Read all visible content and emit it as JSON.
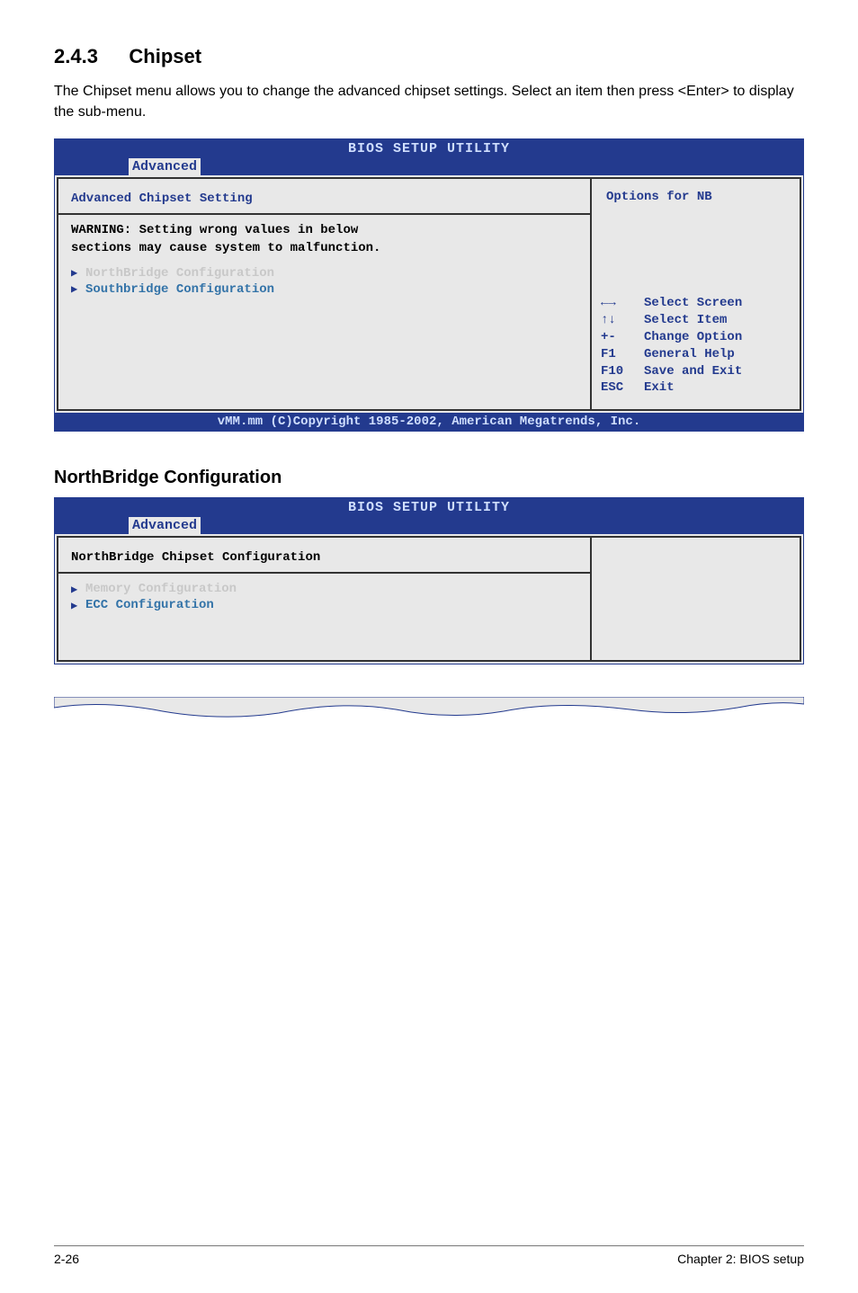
{
  "section": {
    "number": "2.4.3",
    "title": "Chipset",
    "body": "The Chipset menu allows you to change the advanced chipset settings. Select an item then press <Enter> to display the sub-menu."
  },
  "bios1": {
    "header_title": "BIOS SETUP UTILITY",
    "tab": "Advanced",
    "section_heading": "Advanced Chipset Setting",
    "warning_line1": "WARNING: Setting wrong values in below",
    "warning_line2": "sections may cause system to malfunction.",
    "item1": "NorthBridge Configuration",
    "item2": "Southbridge Configuration",
    "options_text": "Options for NB",
    "help": {
      "k1": "←→",
      "v1": "Select Screen",
      "k2": "↑↓",
      "v2": "Select Item",
      "k3": "+-",
      "v3": "Change Option",
      "k4": "F1",
      "v4": "General Help",
      "k5": "F10",
      "v5": "Save and Exit",
      "k6": "ESC",
      "v6": "Exit"
    },
    "footer": "vMM.mm (C)Copyright 1985-2002, American Megatrends, Inc."
  },
  "subheading": "NorthBridge Configuration",
  "bios2": {
    "header_title": "BIOS SETUP UTILITY",
    "tab": "Advanced",
    "section_heading": "NorthBridge Chipset Configuration",
    "item1": "Memory Configuration",
    "item2": "ECC Configuration"
  },
  "footer": {
    "left": "2-26",
    "right": "Chapter 2: BIOS setup"
  }
}
